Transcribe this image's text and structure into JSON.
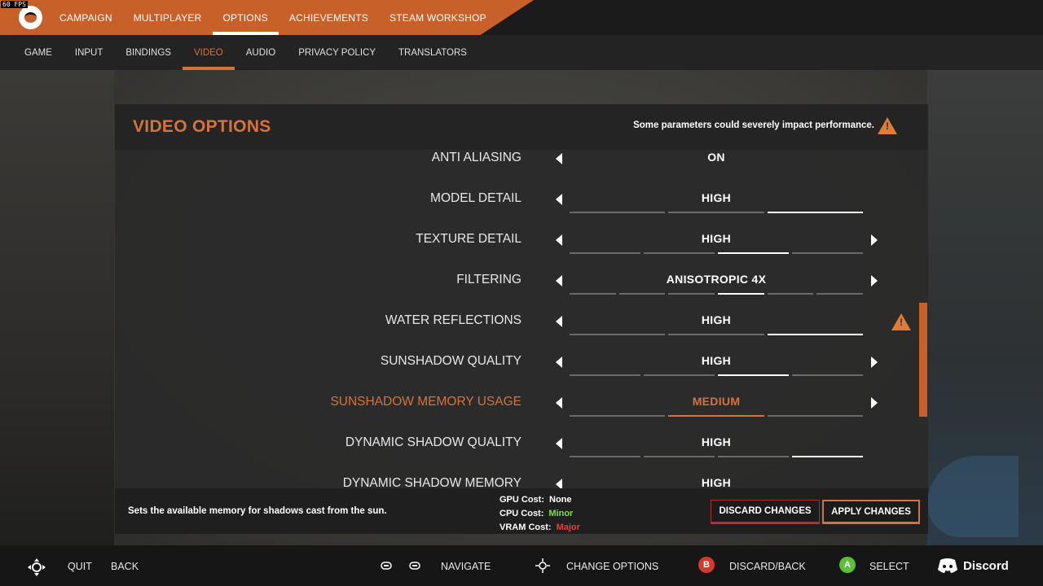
{
  "overlay": {
    "fps": "60 FPS"
  },
  "topnav": {
    "logo_icon": "game-logo-icon",
    "items": [
      "CAMPAIGN",
      "MULTIPLAYER",
      "OPTIONS",
      "ACHIEVEMENTS",
      "STEAM WORKSHOP"
    ],
    "active": "OPTIONS"
  },
  "subnav": {
    "items": [
      "GAME",
      "INPUT",
      "BINDINGS",
      "VIDEO",
      "AUDIO",
      "PRIVACY POLICY",
      "TRANSLATORS"
    ],
    "active": "VIDEO"
  },
  "panel": {
    "title": "VIDEO OPTIONS",
    "warning": "Some parameters could severely impact performance.",
    "warning_icon": "warning-icon"
  },
  "settings": [
    {
      "label": "ANTI ALIASING",
      "value": "ON",
      "segments": 0,
      "level": 0,
      "has_right": false,
      "warn": false
    },
    {
      "label": "MODEL DETAIL",
      "value": "HIGH",
      "segments": 3,
      "level": 3,
      "has_right": false,
      "warn": false
    },
    {
      "label": "TEXTURE DETAIL",
      "value": "HIGH",
      "segments": 4,
      "level": 3,
      "has_right": true,
      "warn": false
    },
    {
      "label": "FILTERING",
      "value": "ANISOTROPIC 4X",
      "segments": 6,
      "level": 4,
      "has_right": true,
      "warn": false
    },
    {
      "label": "WATER REFLECTIONS",
      "value": "HIGH",
      "segments": 3,
      "level": 3,
      "has_right": false,
      "warn": true
    },
    {
      "label": "SUNSHADOW QUALITY",
      "value": "HIGH",
      "segments": 4,
      "level": 3,
      "has_right": true,
      "warn": false
    },
    {
      "label": "SUNSHADOW MEMORY USAGE",
      "value": "MEDIUM",
      "segments": 3,
      "level": 2,
      "has_right": true,
      "warn": false,
      "selected": true
    },
    {
      "label": "DYNAMIC SHADOW QUALITY",
      "value": "HIGH",
      "segments": 4,
      "level": 4,
      "has_right": false,
      "warn": false
    },
    {
      "label": "DYNAMIC SHADOW MEMORY",
      "value": "HIGH",
      "segments": 0,
      "level": 0,
      "has_right": false,
      "warn": false
    }
  ],
  "footer": {
    "description": "Sets the available memory for shadows cast from the sun.",
    "costs": [
      {
        "label": "GPU Cost:",
        "value": "None",
        "color": "#ffffff"
      },
      {
        "label": "CPU Cost:",
        "value": "Minor",
        "color": "#7ee04a"
      },
      {
        "label": "VRAM Cost:",
        "value": "Major",
        "color": "#e0423a"
      }
    ],
    "discard_label": "DISCARD CHANGES",
    "apply_label": "APPLY CHANGES"
  },
  "hints": {
    "quit": "QUIT",
    "back": "BACK",
    "navigate": "NAVIGATE",
    "change_options": "CHANGE OPTIONS",
    "b_button": "B",
    "discard_back": "DISCARD/BACK",
    "a_button": "A",
    "select": "SELECT",
    "discord": "Discord",
    "dpad_icon": "dpad-icon",
    "bumper_icons": [
      "left-bumper-icon",
      "right-bumper-icon"
    ],
    "stick_icon": "stick-icon",
    "discord_icon": "discord-icon"
  },
  "colors": {
    "accent": "#d4743c",
    "topbar_orange": "#c8602a",
    "danger": "#c52b2b",
    "cpu_minor": "#7ee04a",
    "vram_major": "#e0423a"
  }
}
